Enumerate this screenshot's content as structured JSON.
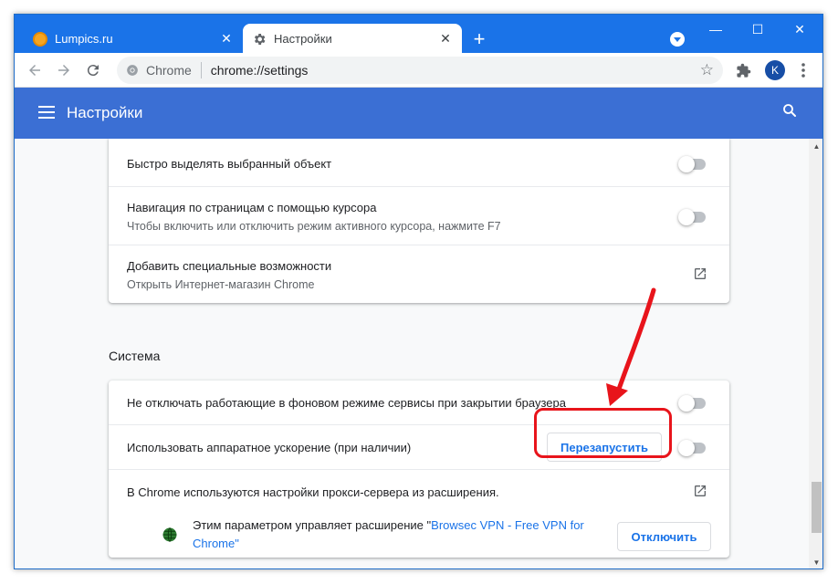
{
  "tabs": [
    {
      "title": "Lumpics.ru",
      "favicon": "lumpics-orange-circle-icon",
      "active": false
    },
    {
      "title": "Настройки",
      "favicon": "gear-icon",
      "active": true
    }
  ],
  "omnibox": {
    "chip": "Chrome",
    "url": "chrome://settings"
  },
  "profile_initial": "K",
  "header": {
    "title": "Настройки"
  },
  "accessibility_card": {
    "rows": [
      {
        "label": "Быстро выделять выбранный объект",
        "toggle": "off"
      },
      {
        "label": "Навигация по страницам с помощью курсора",
        "sub": "Чтобы включить или отключить режим активного курсора, нажмите F7",
        "toggle": "off"
      },
      {
        "label": "Добавить специальные возможности",
        "sub": "Открыть Интернет-магазин Chrome"
      }
    ]
  },
  "system": {
    "title": "Система",
    "rows": [
      {
        "label": "Не отключать работающие в фоновом режиме сервисы при закрытии браузера",
        "toggle": "off"
      },
      {
        "label": "Использовать аппаратное ускорение (при наличии)",
        "toggle": "off",
        "button": "Перезапустить"
      },
      {
        "label": "В Chrome используются настройки прокси-сервера из расширения."
      }
    ],
    "extension_note": {
      "prefix": "Этим параметром управляет расширение \"",
      "name": "Browsec VPN - Free VPN for Chrome",
      "suffix": "\"",
      "button": "Отключить"
    }
  },
  "colors": {
    "accent": "#1a73e8",
    "header": "#3b6fd4",
    "annotation": "#e8141b"
  }
}
